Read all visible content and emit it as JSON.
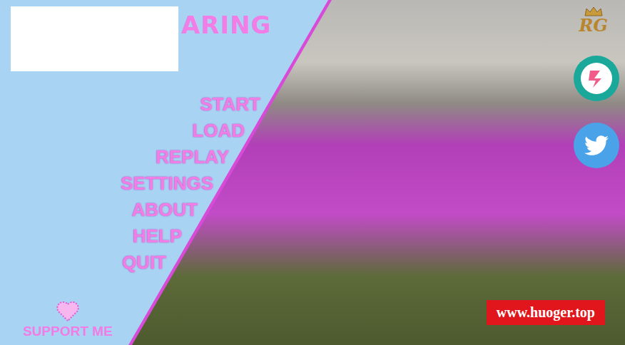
{
  "title": {
    "text": "ARING"
  },
  "menu": [
    {
      "label": "START"
    },
    {
      "label": "LOAD"
    },
    {
      "label": "REPLAY"
    },
    {
      "label": "SETTINGS"
    },
    {
      "label": "ABOUT"
    },
    {
      "label": "HELP"
    },
    {
      "label": "QUIT"
    }
  ],
  "support": {
    "label": "SUPPORT ME"
  },
  "logo": {
    "text": "RG"
  },
  "watermark": {
    "text": "www.huoger.top"
  }
}
